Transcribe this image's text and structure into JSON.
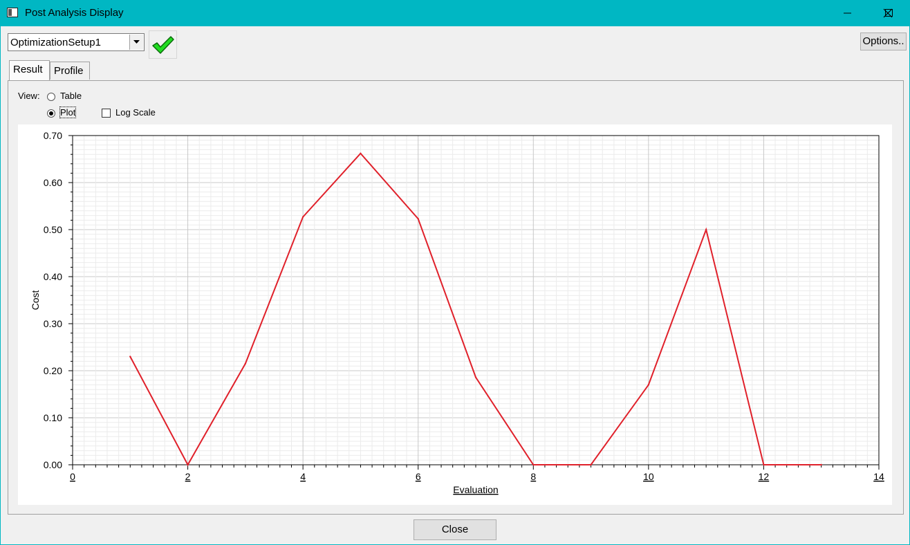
{
  "window": {
    "title": "Post Analysis Display"
  },
  "toolbar": {
    "setup_selected": "OptimizationSetup1",
    "options_label": "Options..",
    "apply_icon": "green-checkmark-icon"
  },
  "tabs": [
    {
      "label": "Result",
      "active": true
    },
    {
      "label": "Profile",
      "active": false
    }
  ],
  "view": {
    "label": "View:",
    "table_label": "Table",
    "plot_label": "Plot",
    "selected": "Plot",
    "log_scale_label": "Log Scale",
    "log_scale_checked": false
  },
  "footer": {
    "close_label": "Close"
  },
  "colors": {
    "line": "#e0202a",
    "titlebar": "#00b7c3"
  },
  "chart_data": {
    "type": "line",
    "title": "",
    "xlabel": "Evaluation",
    "ylabel": "Cost",
    "xlim": [
      0,
      14
    ],
    "ylim": [
      0,
      0.7
    ],
    "xticks": [
      "0",
      "2",
      "4",
      "6",
      "8",
      "10",
      "12",
      "14"
    ],
    "yticks": [
      "0.00",
      "0.10",
      "0.20",
      "0.30",
      "0.40",
      "0.50",
      "0.60",
      "0.70"
    ],
    "grid": true,
    "series": [
      {
        "x": [
          1,
          2,
          3,
          4,
          5,
          6,
          7,
          8,
          9,
          10,
          11,
          12,
          13
        ],
        "y": [
          0.23,
          0.0,
          0.215,
          0.527,
          0.662,
          0.523,
          0.186,
          0.0,
          0.0,
          0.17,
          0.5,
          0.0,
          0.0
        ]
      }
    ]
  }
}
